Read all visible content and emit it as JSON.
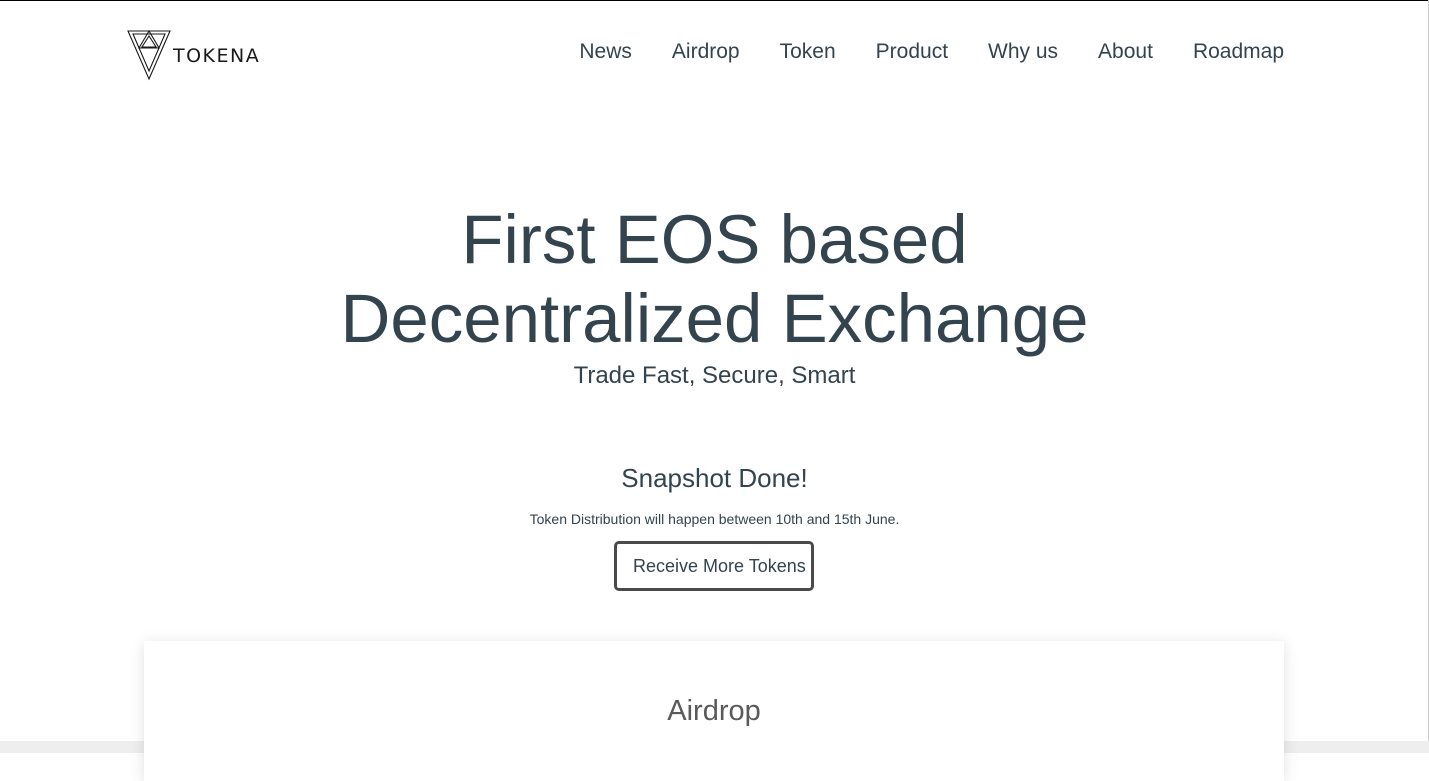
{
  "brand": {
    "logo_text": "TOKENA",
    "logo_icon": "nested-triangles-logo"
  },
  "nav": {
    "items": [
      {
        "label": "News"
      },
      {
        "label": "Airdrop"
      },
      {
        "label": "Token"
      },
      {
        "label": "Product"
      },
      {
        "label": "Why us"
      },
      {
        "label": "About"
      },
      {
        "label": "Roadmap"
      }
    ]
  },
  "hero": {
    "title_line1": "First EOS based",
    "title_line2": "Decentralized Exchange",
    "subtitle": "Trade Fast, Secure, Smart"
  },
  "snapshot": {
    "title": "Snapshot Done!",
    "note": "Token Distribution will happen between 10th and 15th June.",
    "button_label": "Receive More Tokens"
  },
  "airdrop_section": {
    "heading": "Airdrop"
  },
  "colors": {
    "text": "#34444e",
    "button_border": "#4a4a4a",
    "section_heading": "#5a5a5a",
    "background": "#ffffff"
  }
}
